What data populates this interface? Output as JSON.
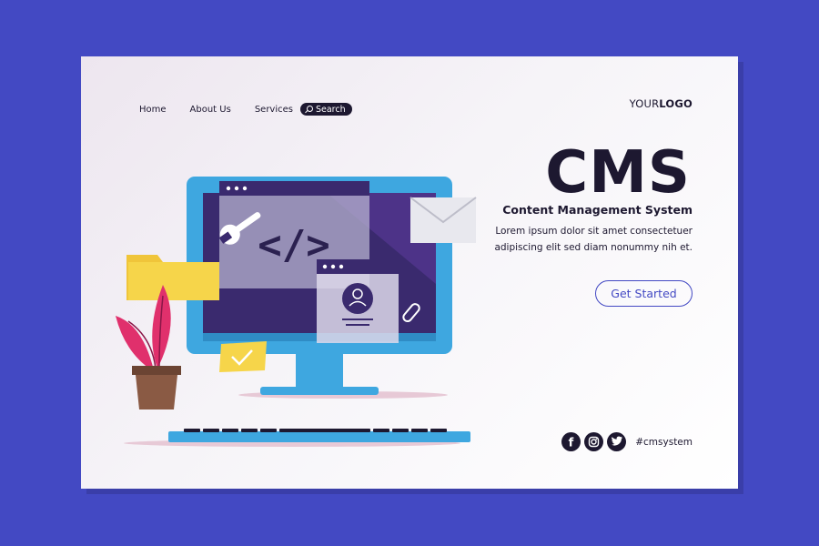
{
  "nav": {
    "items": [
      "Home",
      "About Us",
      "Services"
    ],
    "search_label": "Search"
  },
  "logo": {
    "part1": "YOUR",
    "part2": "LOGO"
  },
  "hero": {
    "title": "CMS",
    "subtitle": "Content Management System",
    "description": "Lorem ipsum dolor sit amet consectetuer adipiscing elit sed diam nonummy nih et."
  },
  "cta_label": "Get Started",
  "social": {
    "icons": [
      "facebook-icon",
      "instagram-icon",
      "twitter-icon"
    ],
    "hashtag": "#cmsystem"
  },
  "colors": {
    "background": "#4349c3",
    "dark": "#1d1830",
    "monitor_blue": "#3ea7e0",
    "screen_purple": "#3a2a6e",
    "folder_yellow": "#f6d54a",
    "plant_pink": "#e0306c"
  }
}
